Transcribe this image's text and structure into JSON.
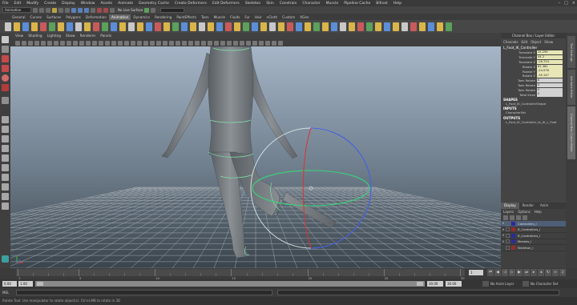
{
  "menubar": {
    "items": [
      "File",
      "Edit",
      "Modify",
      "Create",
      "Display",
      "Window",
      "Assets",
      "Animate",
      "Geometry Cache",
      "Create Deformers",
      "Edit Deformers",
      "Skeleton",
      "Skin",
      "Constrain",
      "Character",
      "Muscle",
      "Pipeline Cache",
      "Bifrost",
      "Help"
    ]
  },
  "statusline": {
    "mode": "Animation",
    "live_surface": "No Live Surface"
  },
  "shelf": {
    "tabs": [
      "General",
      "Curves",
      "Surfaces",
      "Polygons",
      "Deformation",
      "Animation",
      "Dynamics",
      "Rendering",
      "PaintEffects",
      "Toon",
      "Muscle",
      "Fluids",
      "Fur",
      "Hair",
      "nCloth",
      "Custom",
      "XGen"
    ],
    "active_tab": "Animation"
  },
  "panel": {
    "menu": [
      "View",
      "Shading",
      "Lighting",
      "Show",
      "Renderer",
      "Panels"
    ]
  },
  "channel_box": {
    "title": "Channel Box / Layer Editor",
    "menu": [
      "Channels",
      "Edit",
      "Object",
      "Show"
    ],
    "node": "L_Foot_IK_Controller",
    "attributes": [
      {
        "label": "Translate X",
        "value": "25.299"
      },
      {
        "label": "Translate Y",
        "value": "44.2"
      },
      {
        "label": "Translate Z",
        "value": "-26.724"
      },
      {
        "label": "Rotate X",
        "value": "62.362"
      },
      {
        "label": "Rotate Y",
        "value": "-24.576"
      },
      {
        "label": "Rotate Z",
        "value": "-35.147"
      },
      {
        "label": "Toes Rotate",
        "value": "0"
      },
      {
        "label": "Toes Rotate",
        "value": "0"
      },
      {
        "label": "Toes Rotate",
        "value": "0"
      },
      {
        "label": "Total Knee",
        "value": "0"
      }
    ],
    "shapes_label": "SHAPES",
    "shape": "L_Foot_IK_ControllerShape",
    "inputs_label": "INPUTS",
    "input": "CharacterSet",
    "outputs_label": "OUTPUTS",
    "output": "L_Foot_IK_Controller_to_IK_L_Foot"
  },
  "layer_editor": {
    "tabs": [
      "Display",
      "Render",
      "Anim"
    ],
    "active_tab": "Display",
    "menu": [
      "Layers",
      "Options",
      "Help"
    ],
    "layers": [
      {
        "vis": "V",
        "name": "Controllers_l",
        "color": "#2b2b9a",
        "selected": true
      },
      {
        "vis": "V",
        "name": "R_Controllers_l",
        "color": "#9a2b2b",
        "selected": false
      },
      {
        "vis": "V",
        "name": "R_Controllers_l",
        "color": "#2b2b9a",
        "selected": false
      },
      {
        "vis": "V",
        "name": "Meshes_l",
        "color": "#2b2b9a",
        "selected": false
      },
      {
        "vis": "",
        "name": "Skeleton_l",
        "color": "#9a2b2b",
        "selected": false
      }
    ]
  },
  "right_tabs": [
    "Tool Settings",
    "Attribute Editor",
    "Channel Box / Layer Editor"
  ],
  "timeslider": {
    "ticks": [
      "1",
      "",
      "",
      "",
      "5",
      "",
      "",
      "",
      "",
      "10",
      "",
      "",
      "",
      "",
      "15",
      "",
      "",
      "",
      "",
      "20",
      "",
      "",
      "",
      "",
      "25",
      "",
      "",
      "",
      "",
      "30"
    ],
    "current_frame": "1"
  },
  "range": {
    "start": "0.00",
    "inner_start": "1.00",
    "inner_end": "30.00",
    "end": "30.00",
    "anim_layer": "No Anim Layer",
    "character_set": "No Character Set"
  },
  "cmdline": {
    "lang": "MEL"
  },
  "helpline": {
    "text": "Rotate Tool: Use manipulator to rotate object(s). Ctrl+LMB to rotate in 3D"
  },
  "colors": {
    "selection_green": "#7fe0a8",
    "grid": "#b8b8b8",
    "viewport_top": "#9fb0c4",
    "viewport_bottom": "#3b4650"
  }
}
